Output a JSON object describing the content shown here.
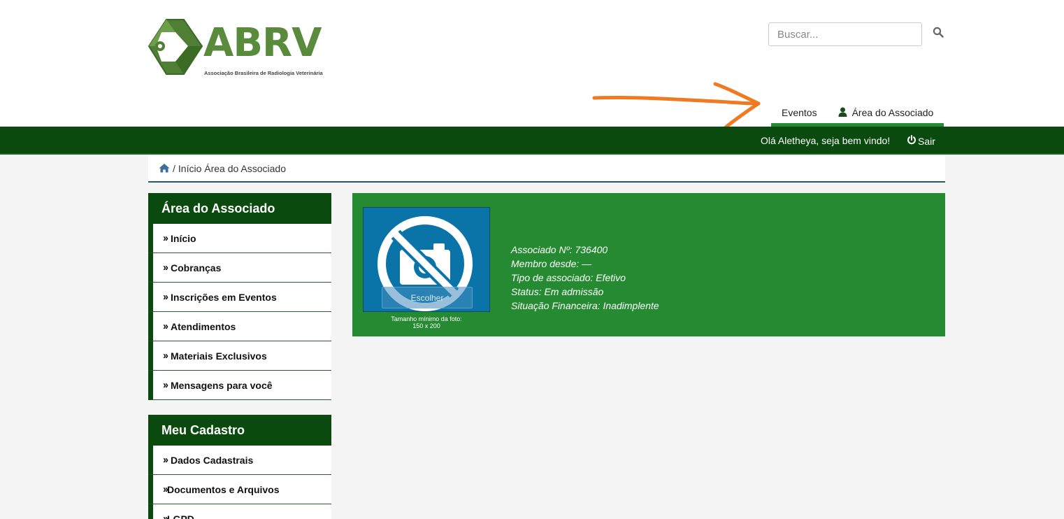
{
  "header": {
    "logo_text": "ABRV",
    "logo_subtitle": "Associação Brasileira de Radiologia Veterinária",
    "search_placeholder": "Buscar...",
    "nav": [
      {
        "label": "Eventos"
      },
      {
        "label": "Área do Associado",
        "icon": "user-icon"
      }
    ]
  },
  "topbar": {
    "greeting": "Olá Aletheya, seja bem vindo!",
    "logout_label": "Sair"
  },
  "breadcrumb": {
    "separator": "/",
    "text": "Início Área do Associado"
  },
  "sidebar": {
    "area_title": "Área do Associado",
    "area_items": [
      {
        "label": "Início"
      },
      {
        "label": "Cobranças"
      },
      {
        "label": "Inscrições em Eventos"
      },
      {
        "label": "Atendimentos"
      },
      {
        "label": "Materiais Exclusivos"
      },
      {
        "label": "Mensagens para você"
      }
    ],
    "cadastro_title": "Meu Cadastro",
    "cadastro_items": [
      {
        "label": "Dados Cadastrais"
      },
      {
        "label": "Documentos e Arquivos"
      },
      {
        "label": "LGPD"
      }
    ]
  },
  "profile": {
    "choose_label": "Escolher",
    "photo_hint_line1": "Tamanho mínimo da foto:",
    "photo_hint_line2": "150 x 200",
    "member_number": "Associado Nº: 736400",
    "member_since": "Membro desde: —",
    "member_type": "Tipo de associado: Efetivo",
    "status": "Status: Em admissão",
    "financial": "Situação Financeira: Inadimplente"
  },
  "colors": {
    "dark_green": "#0b4a0e",
    "profile_green": "#258a32",
    "logo_green": "#5a8a3c",
    "annotation_orange": "#f07a22"
  }
}
